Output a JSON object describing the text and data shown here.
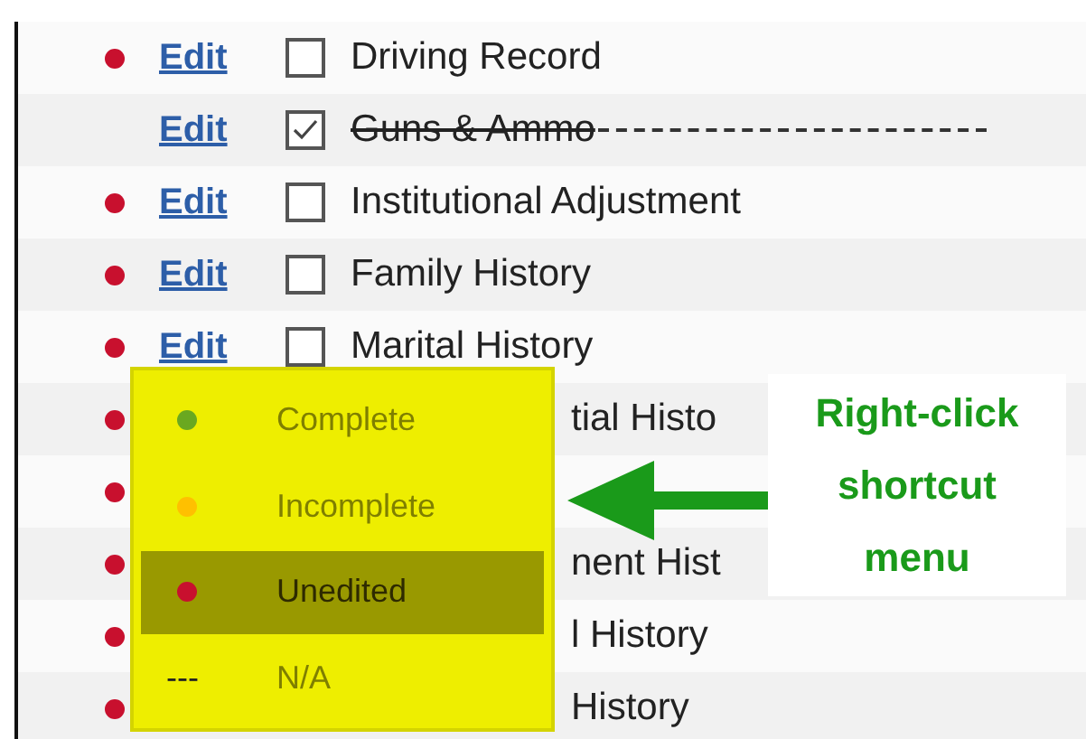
{
  "rows": [
    {
      "kind": "row",
      "color": "#c8102e",
      "link": "Edit",
      "checked": false,
      "label": "Driving Record"
    },
    {
      "kind": "row",
      "link": "Edit",
      "checked": true,
      "label": "Guns & Ammo"
    },
    {
      "kind": "row",
      "color": "#c8102e",
      "link": "Edit",
      "checked": false,
      "label": "Institutional Adjustment"
    },
    {
      "kind": "row",
      "color": "#c8102e",
      "link": "Edit",
      "checked": false,
      "label": "Family History"
    },
    {
      "kind": "row",
      "color": "#c8102e",
      "link": "Edit",
      "checked": false,
      "label": "Marital History"
    },
    {
      "kind": "covered",
      "color": "#c8102e",
      "label": "tial Histo"
    },
    {
      "kind": "covered",
      "color": "#c8102e"
    },
    {
      "kind": "covered",
      "color": "#c8102e",
      "label": "nent Hist"
    },
    {
      "kind": "covered",
      "color": "#c8102e",
      "label": "l History"
    },
    {
      "kind": "covered",
      "color": "#c8102e",
      "label": "History"
    }
  ],
  "context_menu": {
    "items": [
      {
        "kind": "dot",
        "label": "Complete",
        "color": "#6aa820",
        "selected": false
      },
      {
        "kind": "dot",
        "label": "Incomplete",
        "color": "#ffc000",
        "selected": false
      },
      {
        "kind": "dot",
        "label": "Unedited",
        "color": "#c8102e",
        "selected": true
      },
      {
        "kind": "dash",
        "marker": "---",
        "label": "N/A",
        "selected": false
      }
    ]
  },
  "callout": {
    "text": "Right-click shortcut menu"
  }
}
